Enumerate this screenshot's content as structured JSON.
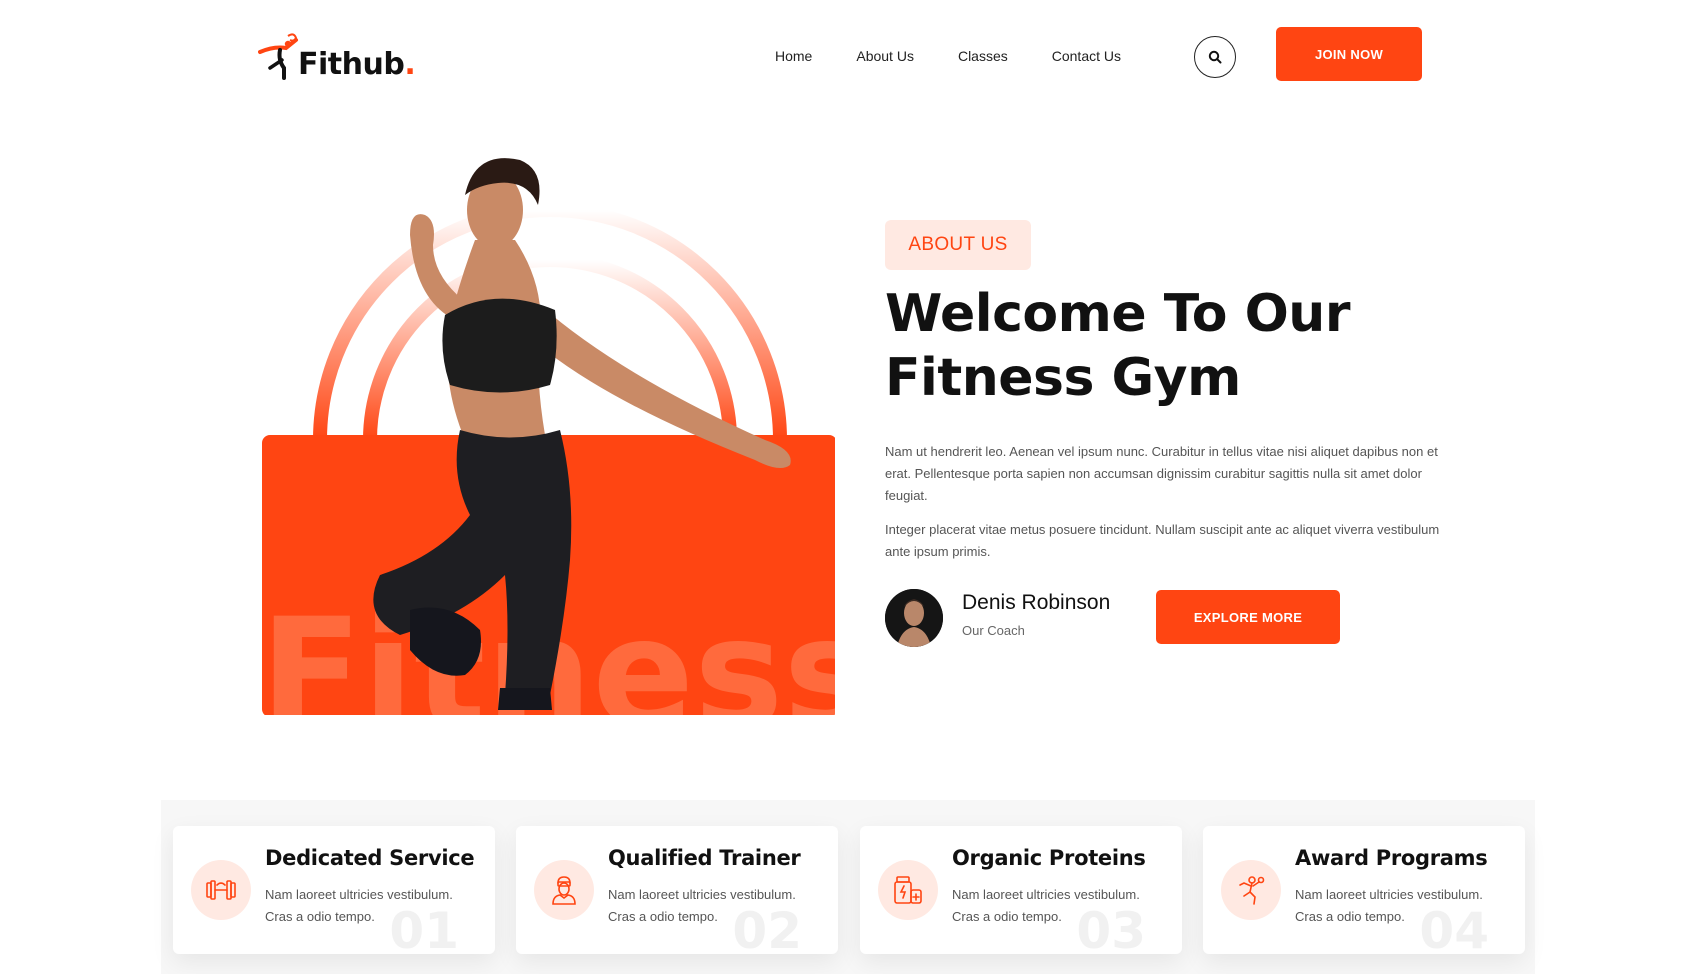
{
  "brand": {
    "name": "Fithub",
    "dot": ".",
    "accent_color": "#ff4512"
  },
  "nav": {
    "items": [
      "Home",
      "About Us",
      "Classes",
      "Contact Us"
    ],
    "search_icon": "search-icon",
    "join_label": "JOIN NOW"
  },
  "hero": {
    "watermark": "Fitness",
    "badge": "ABOUT US",
    "title_line1": "Welcome To Our",
    "title_line2": "Fitness Gym",
    "paragraph1": "Nam ut hendrerit leo. Aenean vel ipsum nunc. Curabitur in tellus vitae nisi aliquet dapibus non et erat. Pellentesque porta sapien non accumsan dignissim curabitur sagittis nulla sit amet dolor feugiat.",
    "paragraph2": "Integer placerat vitae metus posuere tincidunt. Nullam suscipit ante ac aliquet viverra vestibulum ante ipsum primis.",
    "coach_name": "Denis Robinson",
    "coach_role": "Our Coach",
    "explore_label": "EXPLORE MORE"
  },
  "features": [
    {
      "title": "Dedicated Service",
      "text": "Nam laoreet ultricies vestibulum. Cras a odio tempo.",
      "number": "01",
      "icon": "dumbbell-icon"
    },
    {
      "title": "Qualified Trainer",
      "text": "Nam laoreet ultricies vestibulum. Cras a odio tempo.",
      "number": "02",
      "icon": "trainer-icon"
    },
    {
      "title": "Organic Proteins",
      "text": "Nam laoreet ultricies vestibulum. Cras a odio tempo.",
      "number": "03",
      "icon": "protein-icon"
    },
    {
      "title": "Award Programs",
      "text": "Nam laoreet ultricies vestibulum. Cras a odio tempo.",
      "number": "04",
      "icon": "award-icon"
    }
  ]
}
